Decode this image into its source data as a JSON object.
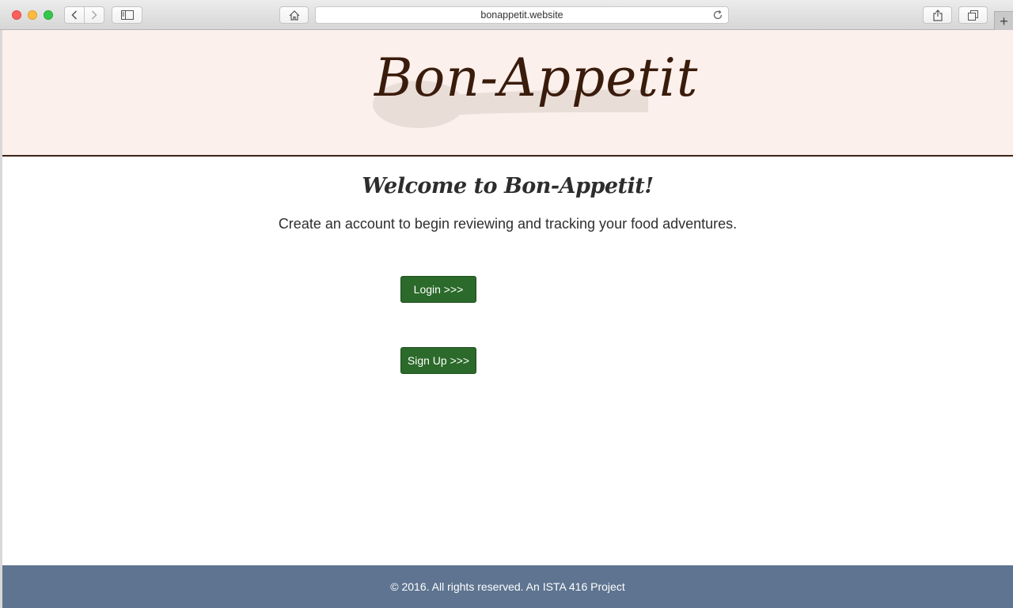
{
  "browser": {
    "url": "bonappetit.website"
  },
  "header": {
    "logo_text": "Bon-Appetit"
  },
  "main": {
    "welcome": "Welcome to Bon-Appetit!",
    "subtitle": "Create an account to begin reviewing and tracking your food adventures.",
    "login_label": "Login >>>",
    "signup_label": "Sign Up >>>"
  },
  "footer": {
    "text": "© 2016. All rights reserved. An ISTA 416 Project"
  },
  "colors": {
    "header_bg": "#fcf0ec",
    "button_green": "#2b6a2a",
    "footer_bg": "#5e7490",
    "logo_brown": "#3a1c0c"
  }
}
